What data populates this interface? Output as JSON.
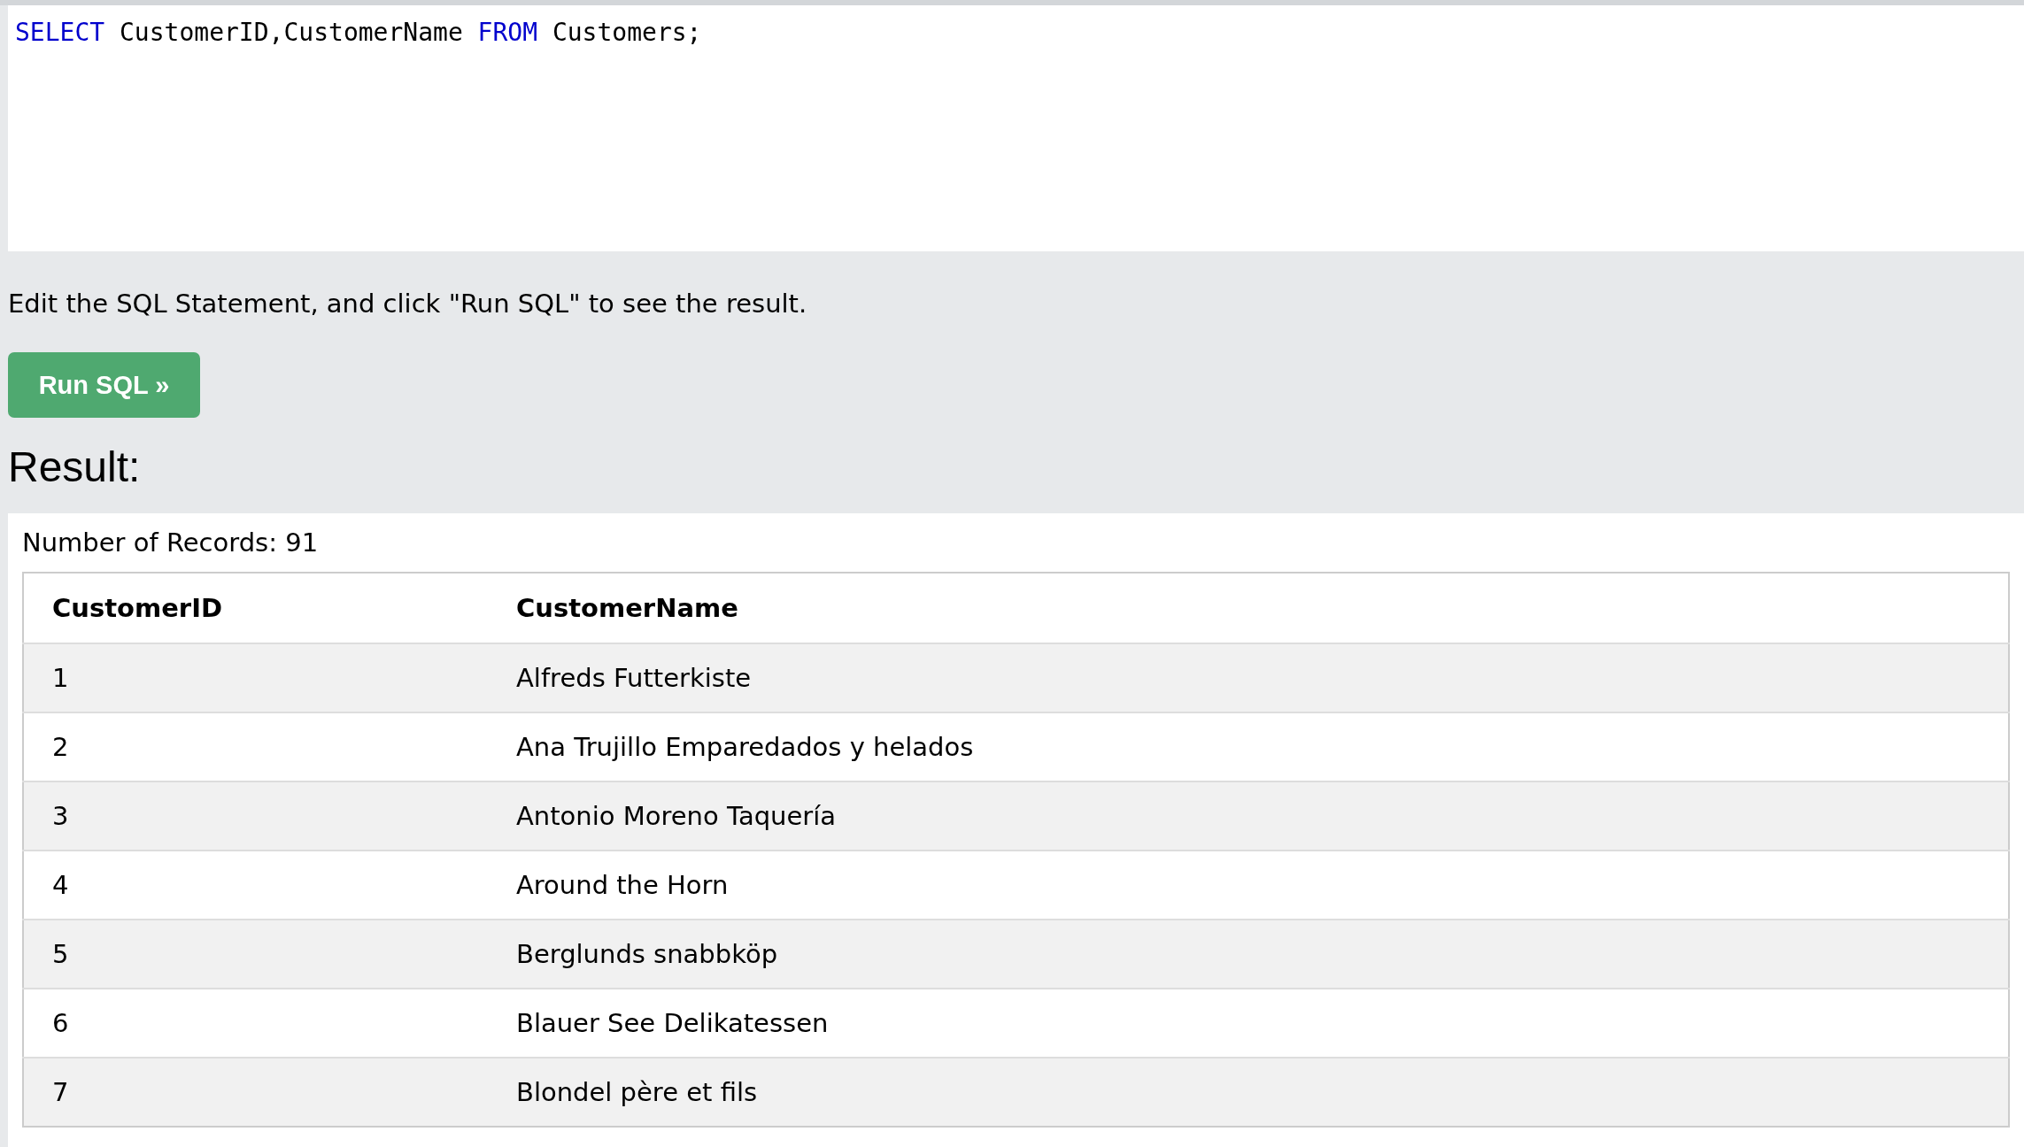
{
  "editor": {
    "tokens": [
      {
        "kind": "keyword",
        "text": "SELECT"
      },
      {
        "kind": "plain",
        "text": " CustomerID,CustomerName "
      },
      {
        "kind": "keyword",
        "text": "FROM"
      },
      {
        "kind": "plain",
        "text": " Customers;"
      }
    ]
  },
  "instructions": "Edit the SQL Statement, and click \"Run SQL\" to see the result.",
  "run_button": "Run SQL »",
  "result_heading": "Result:",
  "record_count": "Number of Records: 91",
  "table": {
    "columns": [
      "CustomerID",
      "CustomerName"
    ],
    "rows": [
      [
        "1",
        "Alfreds Futterkiste"
      ],
      [
        "2",
        "Ana Trujillo Emparedados y helados"
      ],
      [
        "3",
        "Antonio Moreno Taquería"
      ],
      [
        "4",
        "Around the Horn"
      ],
      [
        "5",
        "Berglunds snabbköp"
      ],
      [
        "6",
        "Blauer See Delikatessen"
      ],
      [
        "7",
        "Blondel père et fils"
      ]
    ]
  }
}
